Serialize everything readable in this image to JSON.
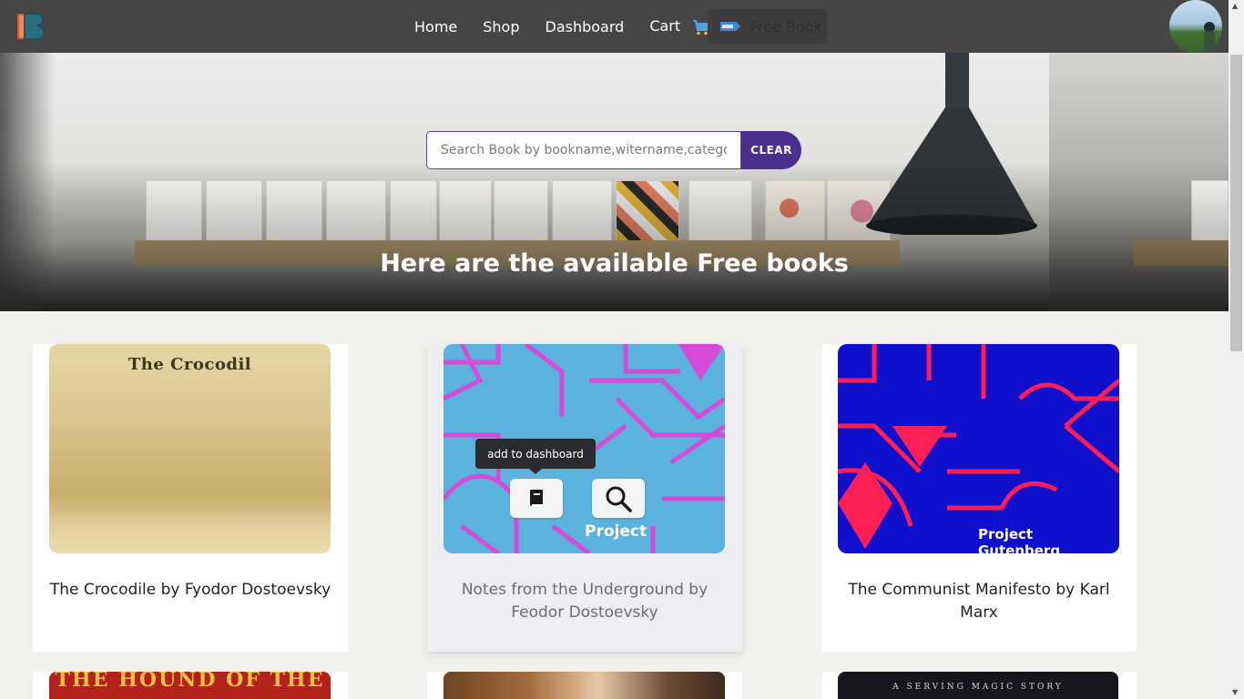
{
  "nav": {
    "links": [
      "Home",
      "Shop",
      "Dashboard",
      "Cart"
    ],
    "free_book_label": "Free Book"
  },
  "search": {
    "placeholder": "Search Book by bookname,witername,category",
    "value": "",
    "clear_label": "CLEAR"
  },
  "hero": {
    "title": "Here are the available Free books"
  },
  "books": [
    {
      "title": "The Crocodile by Fyodor Dostoevsky",
      "cover_text": "The Crocodil"
    },
    {
      "title": "Notes from the Underground by Feodor Dostoevsky",
      "cover_text": "Project"
    },
    {
      "title": "The Communist Manifesto by Karl Marx",
      "cover_text": "Project Gutenberg"
    }
  ],
  "row2_covers": [
    {
      "cover_text": "THE HOUND OF THE"
    },
    {
      "cover_text": ""
    },
    {
      "cover_text": "A SERVING MAGIC STORY"
    }
  ],
  "tooltip": "add to dashboard",
  "colors": {
    "navbar": "#454545",
    "accent": "#4b2e8e",
    "page_bg": "#f2f1ee"
  },
  "icons": [
    "logo-icon",
    "cart-icon",
    "free-tag-icon",
    "book-icon",
    "search-icon"
  ]
}
